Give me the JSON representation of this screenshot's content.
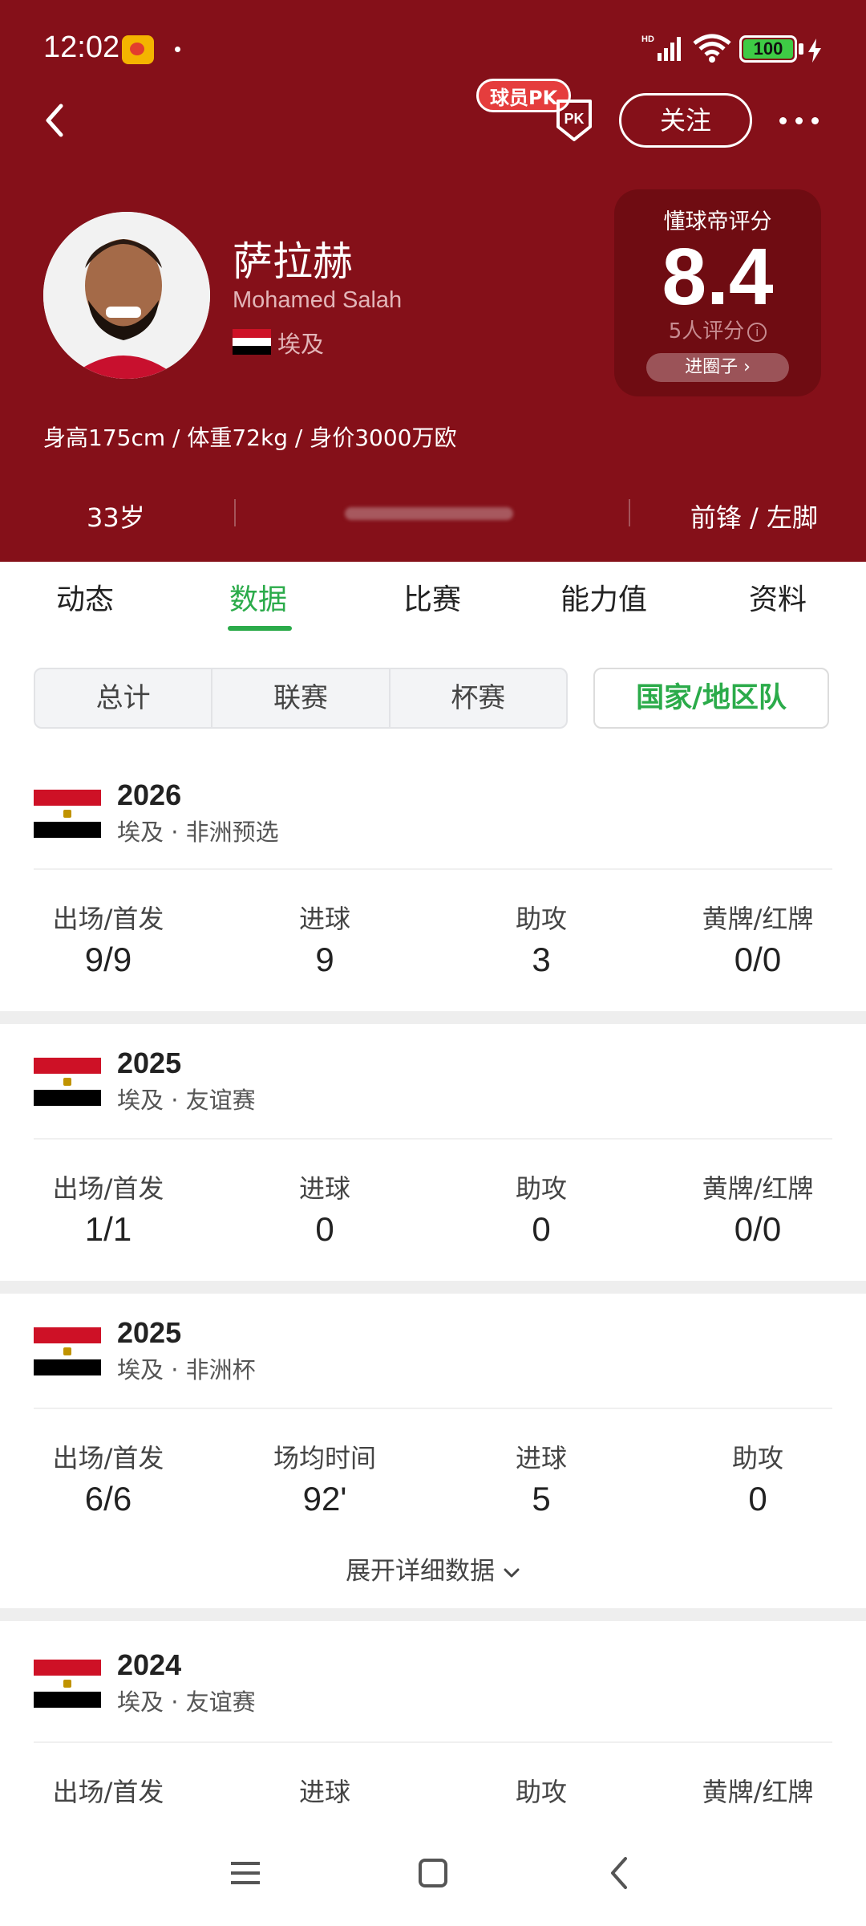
{
  "status_bar": {
    "time": "12:02",
    "battery": "100"
  },
  "header": {
    "pk_badge": "球员PK",
    "pk_icon_label": "PK",
    "follow_label": "关注",
    "player": {
      "name_cn": "萨拉赫",
      "name_en": "Mohamed Salah",
      "country": "埃及",
      "body_info": "身高175cm / 体重72kg / 身价3000万欧",
      "age": "33岁",
      "position": "前锋 / 左脚"
    },
    "rating": {
      "title": "懂球帝评分",
      "score": "8.4",
      "count": "5人评分",
      "button": "进圈子"
    }
  },
  "tabs": [
    "动态",
    "数据",
    "比赛",
    "能力值",
    "资料"
  ],
  "active_tab": "数据",
  "filters": [
    "总计",
    "联赛",
    "杯赛"
  ],
  "active_filter": "国家/地区队",
  "sections": [
    {
      "year": "2026",
      "competition": "埃及 · 非洲预选",
      "stats": [
        {
          "label": "出场/首发",
          "value": "9/9"
        },
        {
          "label": "进球",
          "value": "9"
        },
        {
          "label": "助攻",
          "value": "3"
        },
        {
          "label": "黄牌/红牌",
          "value": "0/0"
        }
      ]
    },
    {
      "year": "2025",
      "competition": "埃及 · 友谊赛",
      "stats": [
        {
          "label": "出场/首发",
          "value": "1/1"
        },
        {
          "label": "进球",
          "value": "0"
        },
        {
          "label": "助攻",
          "value": "0"
        },
        {
          "label": "黄牌/红牌",
          "value": "0/0"
        }
      ]
    },
    {
      "year": "2025",
      "competition": "埃及 · 非洲杯",
      "stats": [
        {
          "label": "出场/首发",
          "value": "6/6"
        },
        {
          "label": "场均时间",
          "value": "92'"
        },
        {
          "label": "进球",
          "value": "5"
        },
        {
          "label": "助攻",
          "value": "0"
        }
      ],
      "expand_label": "展开详细数据"
    },
    {
      "year": "2024",
      "competition": "埃及 · 友谊赛",
      "stats": [
        {
          "label": "出场/首发",
          "value": ""
        },
        {
          "label": "进球",
          "value": ""
        },
        {
          "label": "助攻",
          "value": ""
        },
        {
          "label": "黄牌/红牌",
          "value": ""
        }
      ]
    }
  ],
  "colors": {
    "header_bg": "#851019",
    "accent_green": "#2bab4a",
    "rating_bg": "#6f0c12"
  },
  "icons": [
    "back-icon",
    "pk-icon",
    "more-icon",
    "info-icon",
    "chevron-right-icon",
    "chevron-down-icon",
    "menu-icon",
    "home-icon",
    "nav-back-icon"
  ]
}
